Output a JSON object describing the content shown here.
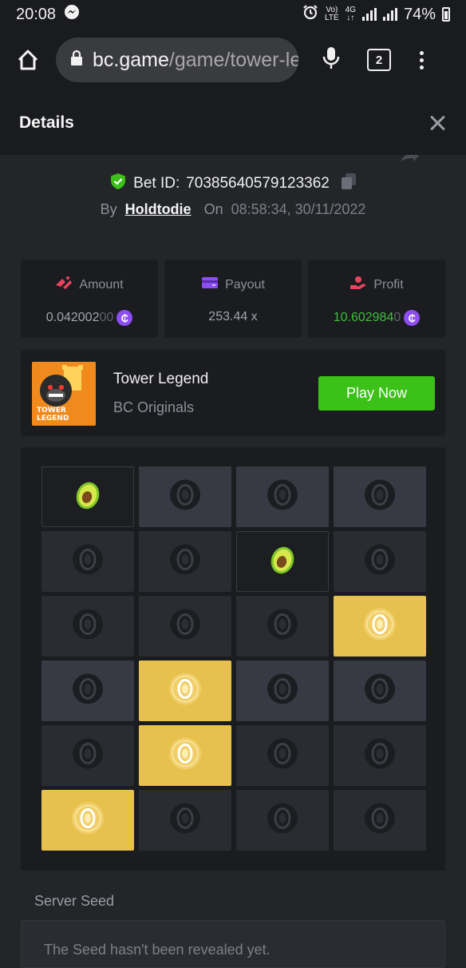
{
  "status_bar": {
    "time": "20:08",
    "net_top": "Vo)",
    "net_bottom": "LTE",
    "gen_top": "4G",
    "gen_bottom": "↓↑",
    "battery": "74%"
  },
  "browser": {
    "url_host": "bc.game",
    "url_path": "/game/tower-legend",
    "tab_count": "2"
  },
  "details": {
    "title": "Details"
  },
  "bet": {
    "id_label": "Bet ID:",
    "id": "70385640579123362",
    "by_label": "By",
    "user": "Holdtodie",
    "on_label": "On",
    "datetime": "08:58:34, 30/11/2022"
  },
  "stats": {
    "amount": {
      "label": "Amount",
      "value": "0.042002",
      "value_dim": "00"
    },
    "payout": {
      "label": "Payout",
      "value": "253.44 x"
    },
    "profit": {
      "label": "Profit",
      "value": "10.602984",
      "value_dim": "0"
    },
    "coin_symbol": "₵"
  },
  "game": {
    "name": "Tower Legend",
    "provider": "BC Originals",
    "play_label": "Play Now",
    "thumb_line1": "TOWER",
    "thumb_line2": "LEGEND"
  },
  "board": {
    "rows": [
      [
        "avocado",
        "closed-light",
        "closed-light",
        "closed-light"
      ],
      [
        "closed-dark",
        "closed-dark",
        "avocado",
        "closed-dark"
      ],
      [
        "closed-dark",
        "closed-dark",
        "closed-dark",
        "gold"
      ],
      [
        "closed-light",
        "gold",
        "closed-light",
        "closed-light"
      ],
      [
        "closed-dark",
        "gold",
        "closed-dark",
        "closed-dark"
      ],
      [
        "gold",
        "closed-dark",
        "closed-dark",
        "closed-dark"
      ]
    ]
  },
  "server_seed": {
    "label": "Server Seed",
    "value": "The Seed hasn't been revealed yet."
  }
}
